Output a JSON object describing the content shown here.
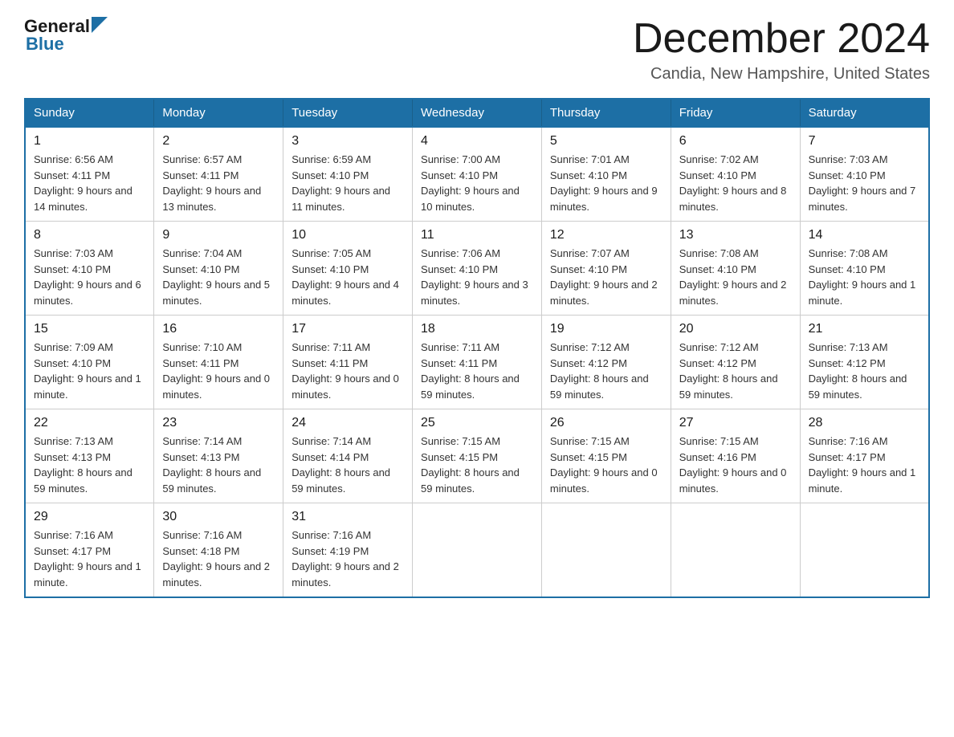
{
  "header": {
    "logo_general": "General",
    "logo_blue": "Blue",
    "month_title": "December 2024",
    "location": "Candia, New Hampshire, United States"
  },
  "weekdays": [
    "Sunday",
    "Monday",
    "Tuesday",
    "Wednesday",
    "Thursday",
    "Friday",
    "Saturday"
  ],
  "weeks": [
    [
      {
        "day": "1",
        "sunrise": "6:56 AM",
        "sunset": "4:11 PM",
        "daylight": "9 hours and 14 minutes."
      },
      {
        "day": "2",
        "sunrise": "6:57 AM",
        "sunset": "4:11 PM",
        "daylight": "9 hours and 13 minutes."
      },
      {
        "day": "3",
        "sunrise": "6:59 AM",
        "sunset": "4:10 PM",
        "daylight": "9 hours and 11 minutes."
      },
      {
        "day": "4",
        "sunrise": "7:00 AM",
        "sunset": "4:10 PM",
        "daylight": "9 hours and 10 minutes."
      },
      {
        "day": "5",
        "sunrise": "7:01 AM",
        "sunset": "4:10 PM",
        "daylight": "9 hours and 9 minutes."
      },
      {
        "day": "6",
        "sunrise": "7:02 AM",
        "sunset": "4:10 PM",
        "daylight": "9 hours and 8 minutes."
      },
      {
        "day": "7",
        "sunrise": "7:03 AM",
        "sunset": "4:10 PM",
        "daylight": "9 hours and 7 minutes."
      }
    ],
    [
      {
        "day": "8",
        "sunrise": "7:03 AM",
        "sunset": "4:10 PM",
        "daylight": "9 hours and 6 minutes."
      },
      {
        "day": "9",
        "sunrise": "7:04 AM",
        "sunset": "4:10 PM",
        "daylight": "9 hours and 5 minutes."
      },
      {
        "day": "10",
        "sunrise": "7:05 AM",
        "sunset": "4:10 PM",
        "daylight": "9 hours and 4 minutes."
      },
      {
        "day": "11",
        "sunrise": "7:06 AM",
        "sunset": "4:10 PM",
        "daylight": "9 hours and 3 minutes."
      },
      {
        "day": "12",
        "sunrise": "7:07 AM",
        "sunset": "4:10 PM",
        "daylight": "9 hours and 2 minutes."
      },
      {
        "day": "13",
        "sunrise": "7:08 AM",
        "sunset": "4:10 PM",
        "daylight": "9 hours and 2 minutes."
      },
      {
        "day": "14",
        "sunrise": "7:08 AM",
        "sunset": "4:10 PM",
        "daylight": "9 hours and 1 minute."
      }
    ],
    [
      {
        "day": "15",
        "sunrise": "7:09 AM",
        "sunset": "4:10 PM",
        "daylight": "9 hours and 1 minute."
      },
      {
        "day": "16",
        "sunrise": "7:10 AM",
        "sunset": "4:11 PM",
        "daylight": "9 hours and 0 minutes."
      },
      {
        "day": "17",
        "sunrise": "7:11 AM",
        "sunset": "4:11 PM",
        "daylight": "9 hours and 0 minutes."
      },
      {
        "day": "18",
        "sunrise": "7:11 AM",
        "sunset": "4:11 PM",
        "daylight": "8 hours and 59 minutes."
      },
      {
        "day": "19",
        "sunrise": "7:12 AM",
        "sunset": "4:12 PM",
        "daylight": "8 hours and 59 minutes."
      },
      {
        "day": "20",
        "sunrise": "7:12 AM",
        "sunset": "4:12 PM",
        "daylight": "8 hours and 59 minutes."
      },
      {
        "day": "21",
        "sunrise": "7:13 AM",
        "sunset": "4:12 PM",
        "daylight": "8 hours and 59 minutes."
      }
    ],
    [
      {
        "day": "22",
        "sunrise": "7:13 AM",
        "sunset": "4:13 PM",
        "daylight": "8 hours and 59 minutes."
      },
      {
        "day": "23",
        "sunrise": "7:14 AM",
        "sunset": "4:13 PM",
        "daylight": "8 hours and 59 minutes."
      },
      {
        "day": "24",
        "sunrise": "7:14 AM",
        "sunset": "4:14 PM",
        "daylight": "8 hours and 59 minutes."
      },
      {
        "day": "25",
        "sunrise": "7:15 AM",
        "sunset": "4:15 PM",
        "daylight": "8 hours and 59 minutes."
      },
      {
        "day": "26",
        "sunrise": "7:15 AM",
        "sunset": "4:15 PM",
        "daylight": "9 hours and 0 minutes."
      },
      {
        "day": "27",
        "sunrise": "7:15 AM",
        "sunset": "4:16 PM",
        "daylight": "9 hours and 0 minutes."
      },
      {
        "day": "28",
        "sunrise": "7:16 AM",
        "sunset": "4:17 PM",
        "daylight": "9 hours and 1 minute."
      }
    ],
    [
      {
        "day": "29",
        "sunrise": "7:16 AM",
        "sunset": "4:17 PM",
        "daylight": "9 hours and 1 minute."
      },
      {
        "day": "30",
        "sunrise": "7:16 AM",
        "sunset": "4:18 PM",
        "daylight": "9 hours and 2 minutes."
      },
      {
        "day": "31",
        "sunrise": "7:16 AM",
        "sunset": "4:19 PM",
        "daylight": "9 hours and 2 minutes."
      },
      null,
      null,
      null,
      null
    ]
  ]
}
